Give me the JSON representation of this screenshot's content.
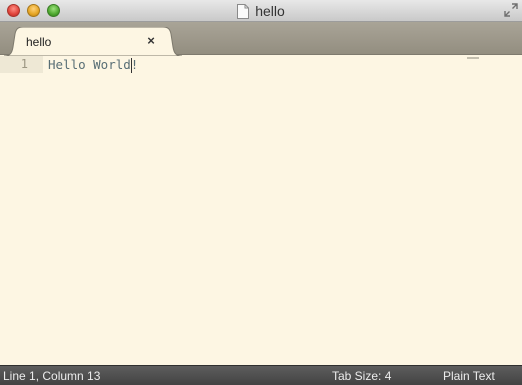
{
  "window": {
    "title": "hello",
    "colors": {
      "titlebar": "#d6d6d6",
      "editor_bg": "#fdf6e3",
      "status_bg": "#4e4e4e"
    }
  },
  "tabs": [
    {
      "label": "hello",
      "active": true,
      "close_glyph": "×"
    }
  ],
  "editor": {
    "lines": [
      {
        "number": "1",
        "text": "Hello World!"
      }
    ]
  },
  "status": {
    "position": "Line 1, Column 13",
    "tab_size": "Tab Size: 4",
    "syntax": "Plain Text"
  },
  "icons": [
    "close-window",
    "minimize-window",
    "zoom-window",
    "document-icon",
    "fullscreen-icon",
    "tab-close-icon"
  ]
}
